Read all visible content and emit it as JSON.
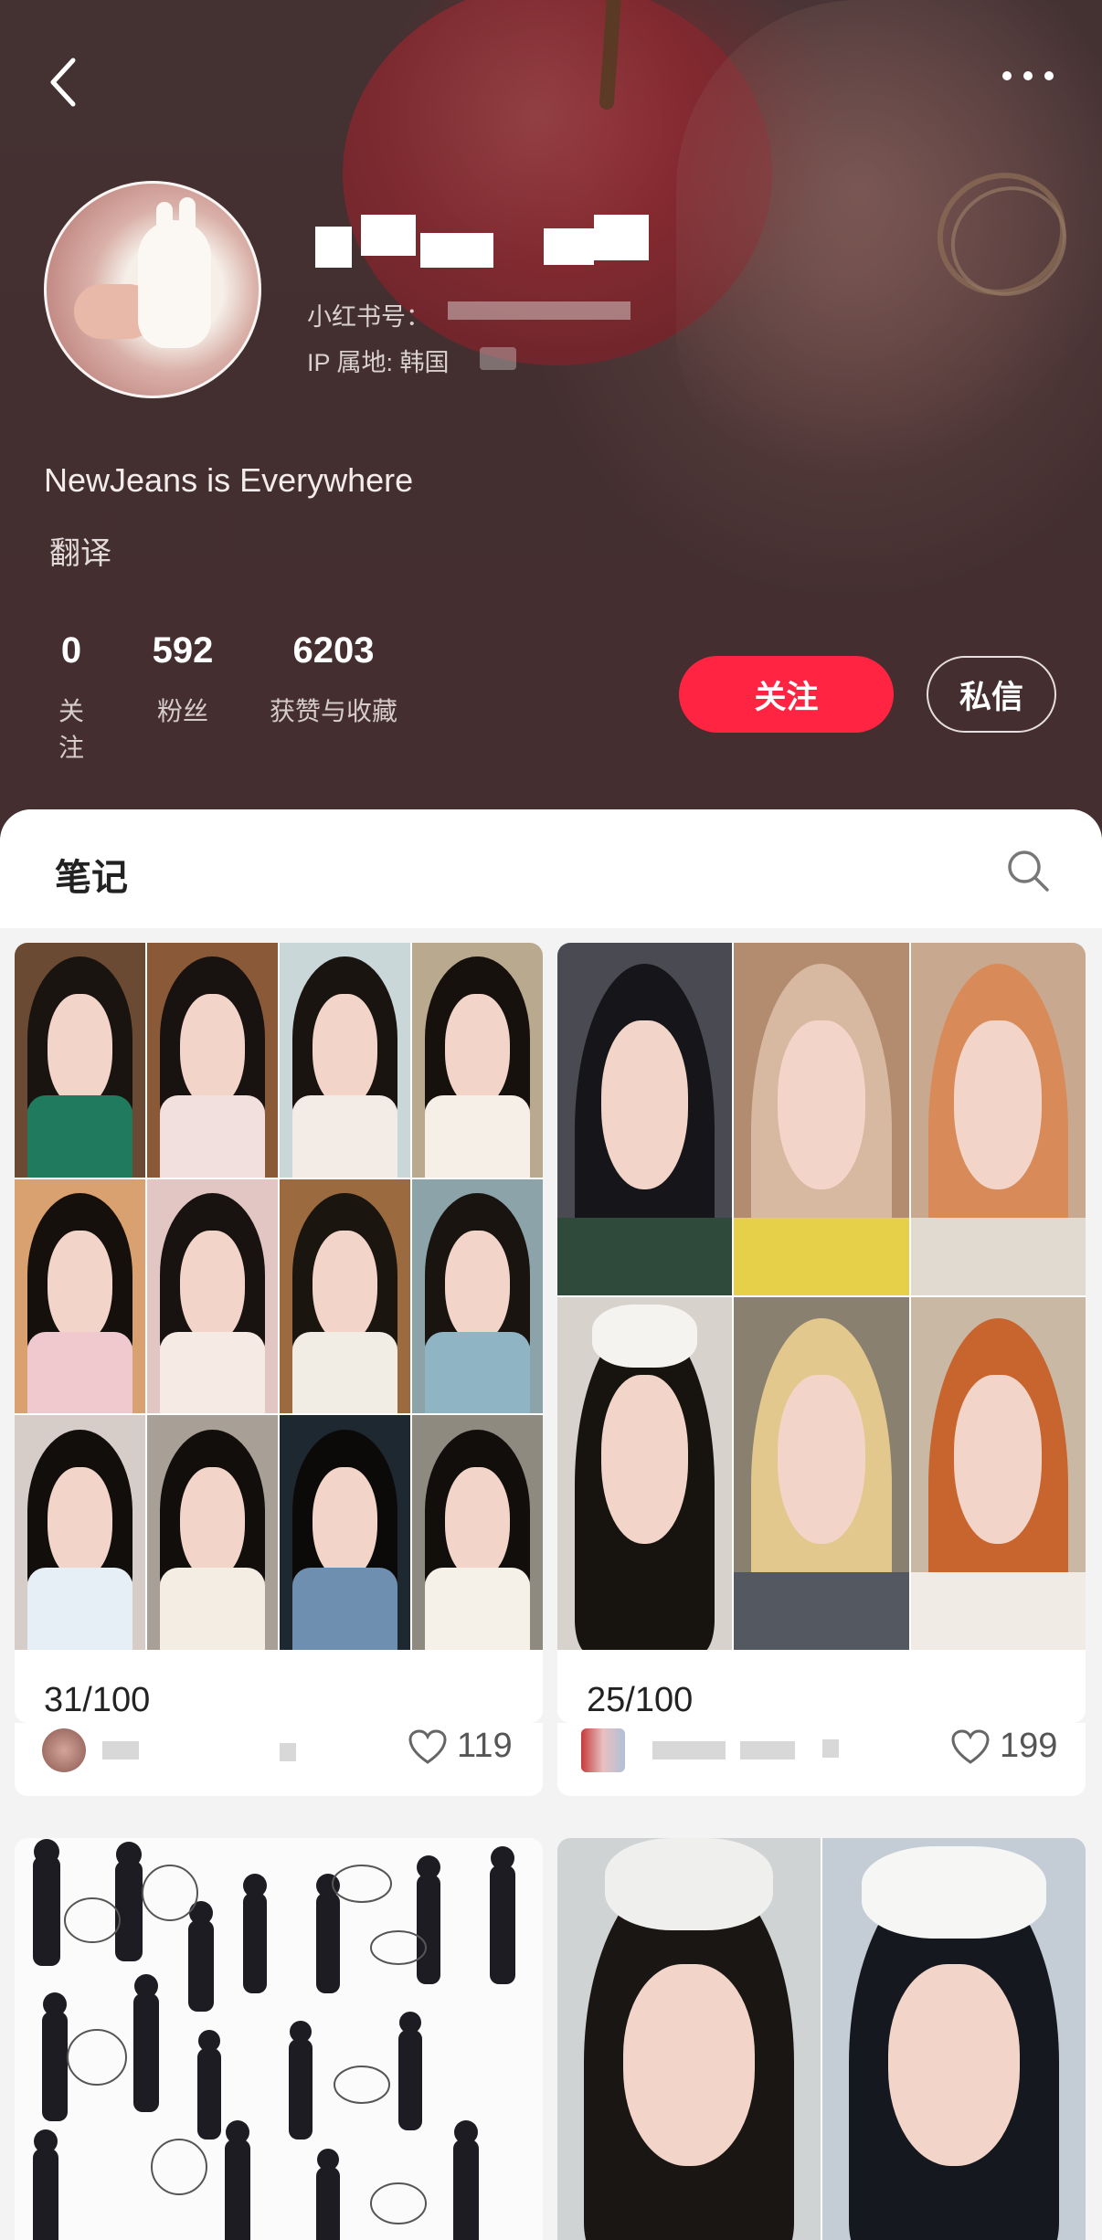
{
  "header": {
    "username_masked": "",
    "redid_label": "小红书号：",
    "ip_label": "IP 属地: 韩国",
    "bio": "NewJeans is Everywhere",
    "translate_label": "翻译",
    "stats": [
      {
        "value": "0",
        "label": "关注"
      },
      {
        "value": "592",
        "label": "粉丝"
      },
      {
        "value": "6203",
        "label": "获赞与收藏"
      }
    ],
    "follow_label": "关注",
    "message_label": "私信"
  },
  "tabs": {
    "notes_label": "笔记"
  },
  "notes": [
    {
      "title": "31/100",
      "likes": "119"
    },
    {
      "title": "25/100",
      "likes": "199"
    }
  ],
  "colors": {
    "accent": "#ff2442",
    "header_bg": "#4b3636"
  },
  "icons": [
    "back-arrow-icon",
    "more-dots-icon",
    "search-icon",
    "heart-icon"
  ]
}
